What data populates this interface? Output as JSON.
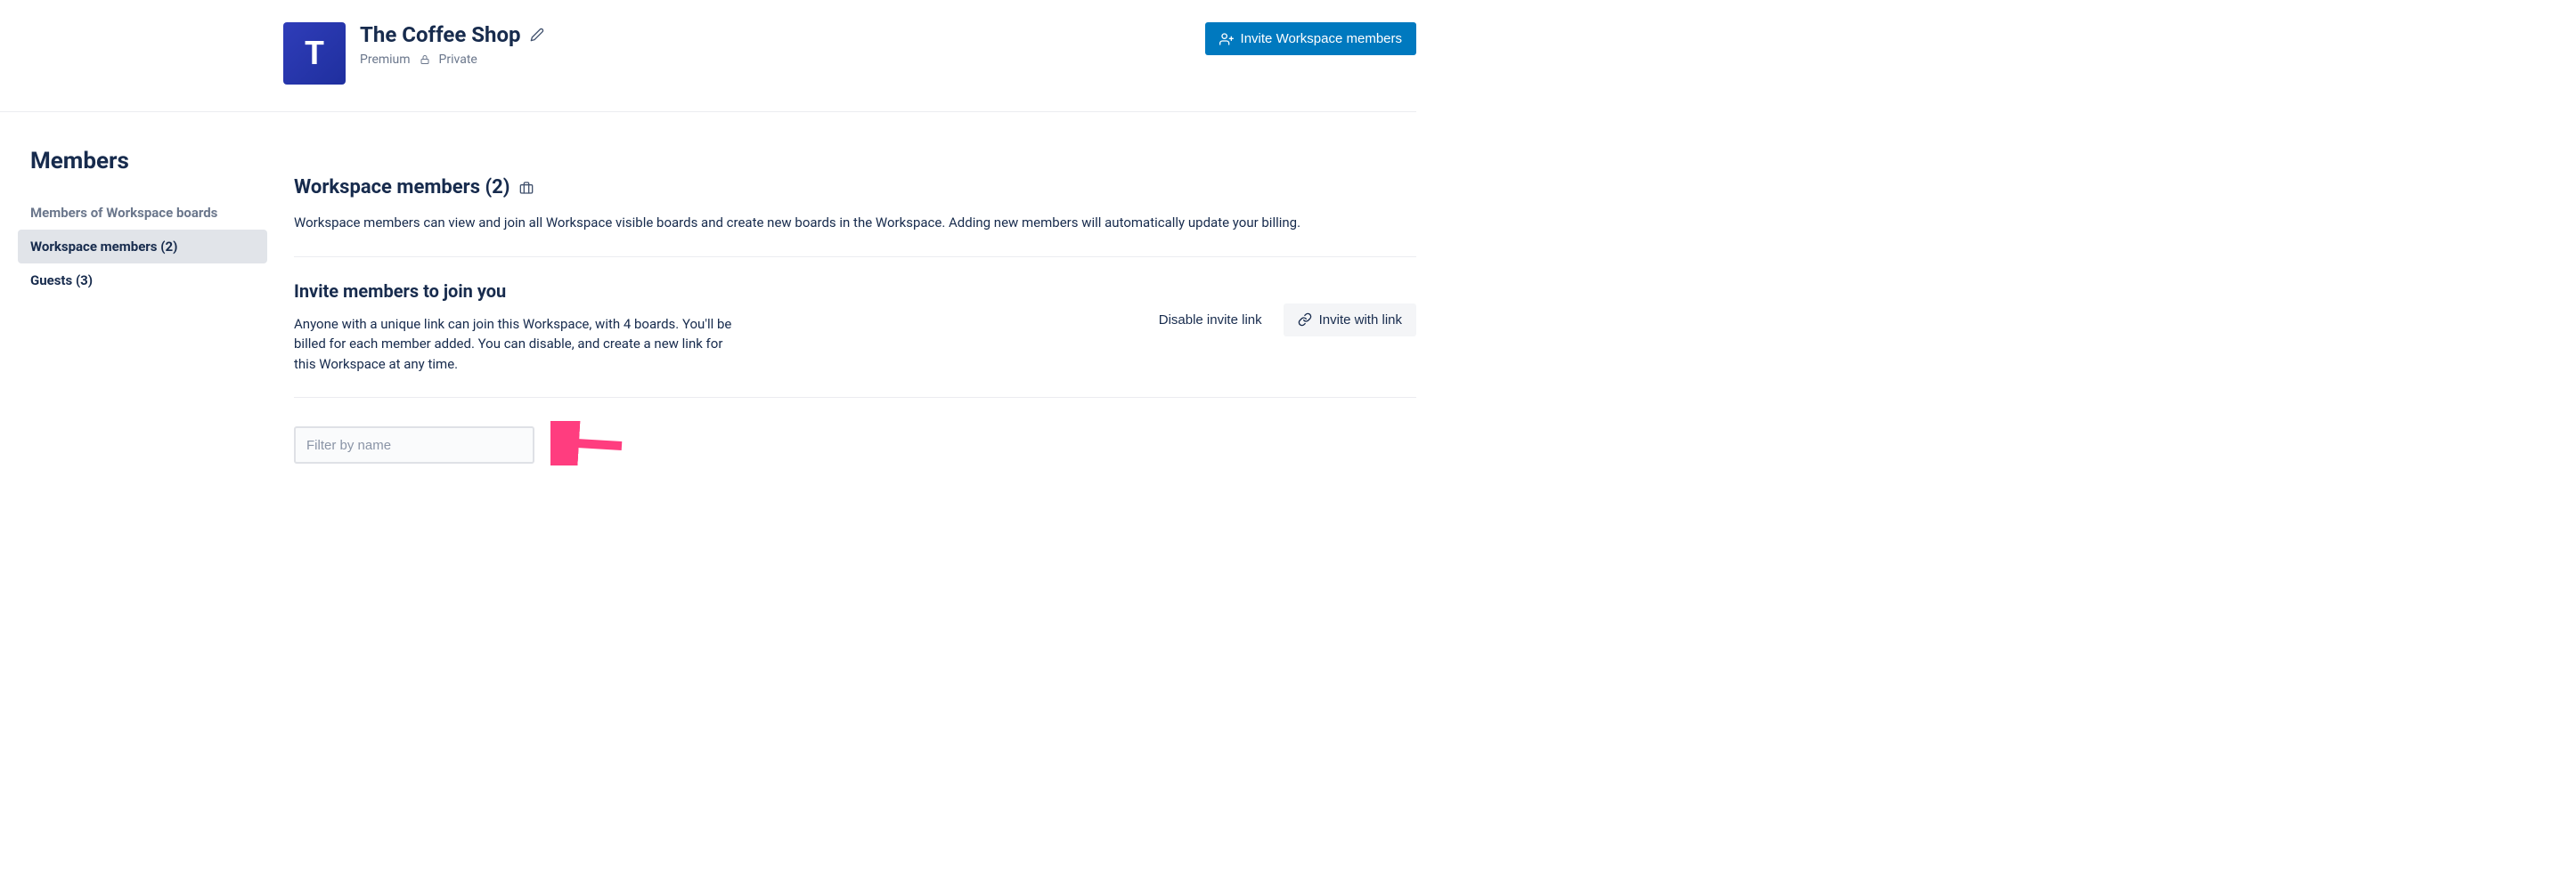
{
  "workspace": {
    "logo_letter": "T",
    "name": "The Coffee Shop",
    "plan": "Premium",
    "visibility": "Private"
  },
  "top_button": {
    "invite_label": "Invite Workspace members"
  },
  "sidebar": {
    "title": "Members",
    "items": [
      {
        "label": "Members of Workspace boards"
      },
      {
        "label": "Workspace members (2)"
      },
      {
        "label": "Guests (3)"
      }
    ]
  },
  "section_members": {
    "title": "Workspace members (2)",
    "description": "Workspace members can view and join all Workspace visible boards and create new boards in the Workspace. Adding new members will automatically update your billing."
  },
  "section_invite": {
    "title": "Invite members to join you",
    "description": "Anyone with a unique link can join this Workspace, with 4 boards. You'll be billed for each member added. You can disable, and create a new link for this Workspace at any time.",
    "disable_label": "Disable invite link",
    "invite_link_label": "Invite with link"
  },
  "filter": {
    "placeholder": "Filter by name"
  }
}
